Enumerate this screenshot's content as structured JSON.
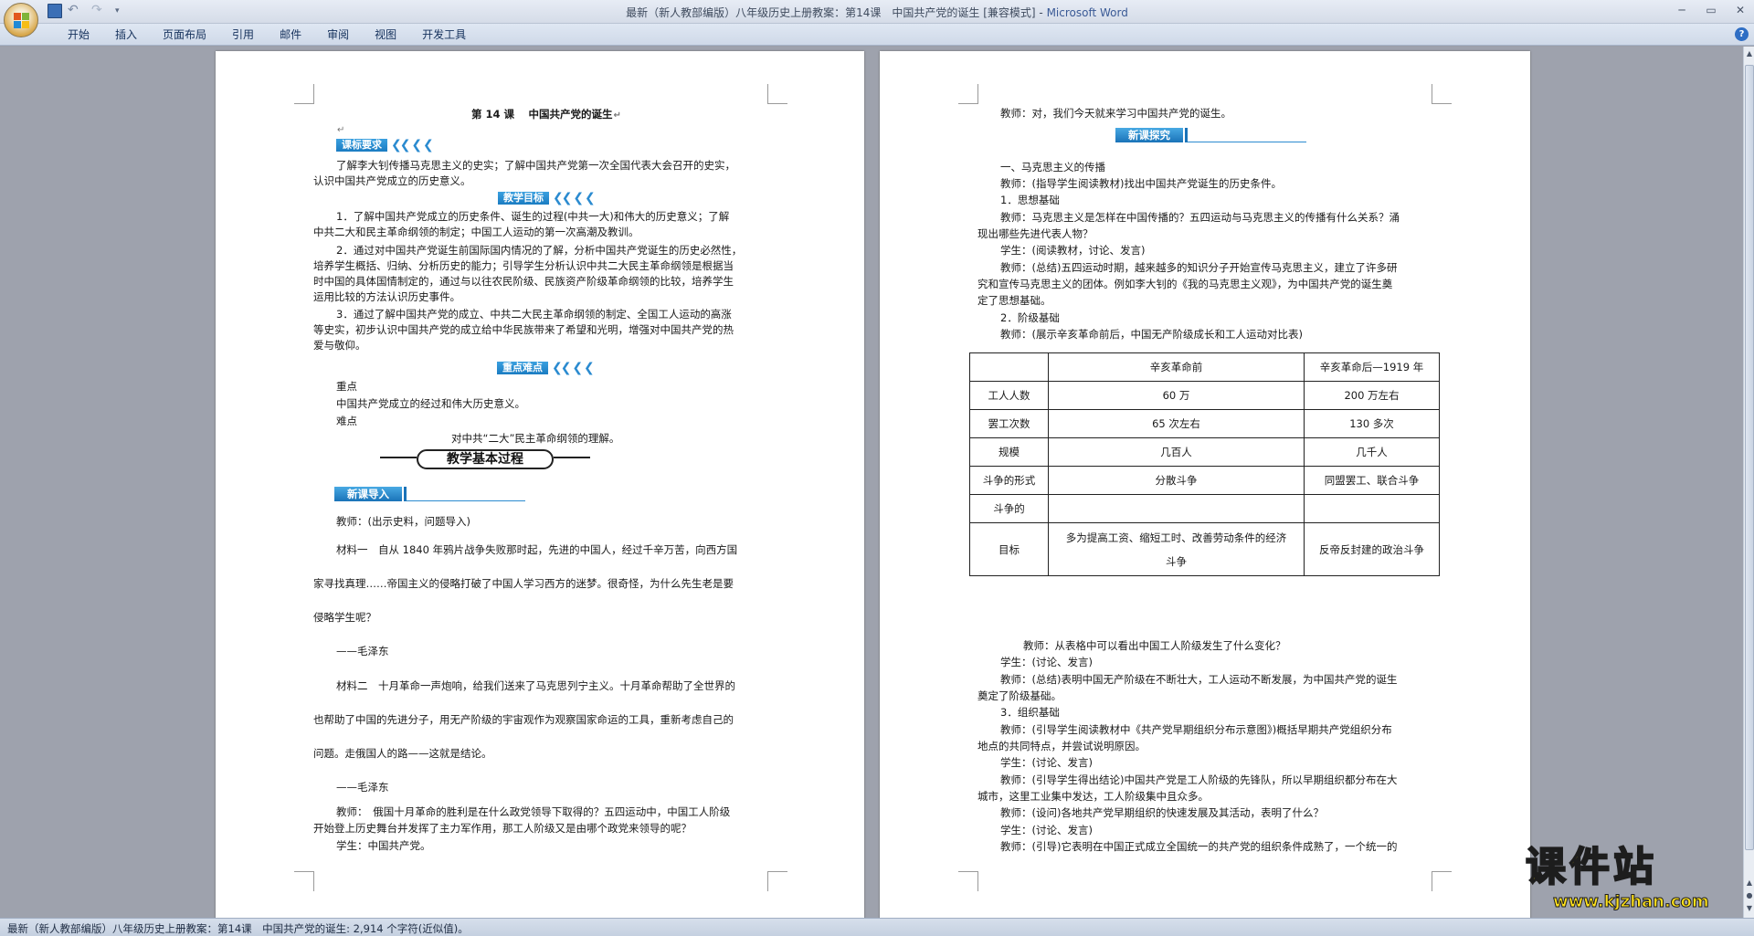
{
  "window": {
    "title": "最新（新人教部编版）八年级历史上册教案：第14课　中国共产党的诞生 [兼容模式]",
    "app_name": "Microsoft Word",
    "dash": " - "
  },
  "ribbon": {
    "tabs": [
      "开始",
      "插入",
      "页面布局",
      "引用",
      "邮件",
      "审阅",
      "视图",
      "开发工具"
    ],
    "help": "?"
  },
  "page1": {
    "title": "第 14 课　 中国共产党的诞生",
    "banner_kbyq": "课标要求",
    "kbyq_l1": "了解李大钊传播马克思主义的史实；了解中国共产党第一次全国代表大会召开的史实，",
    "kbyq_l2": "认识中国共产党成立的历史意义。",
    "banner_jxmb": "教学目标",
    "m1_l1": "1．了解中国共产党成立的历史条件、诞生的过程(中共一大)和伟大的历史意义；了解",
    "m1_l2": "中共二大和民主革命纲领的制定；中国工人运动的第一次高潮及教训。",
    "m2_l1": "2．通过对中国共产党诞生前国际国内情况的了解，分析中国共产党诞生的历史必然性，",
    "m2_l2": "培养学生概括、归纳、分析历史的能力；引导学生分析认识中共二大民主革命纲领是根据当",
    "m2_l3": "时中国的具体国情制定的，通过与以往农民阶级、民族资产阶级革命纲领的比较，培养学生",
    "m2_l4": "运用比较的方法认识历史事件。",
    "m3_l1": "3．通过了解中国共产党的成立、中共二大民主革命纲领的制定、全国工人运动的高涨",
    "m3_l2": "等史实，初步认识中国共产党的成立给中华民族带来了希望和光明，增强对中国共产党的热",
    "m3_l3": "爱与敬仰。",
    "banner_zdnd": "重点难点",
    "zd_label": "重点",
    "zd_text": "中国共产党成立的经过和伟大历史意义。",
    "nd_label": "难点",
    "nd_text": "对中共“二大”民主革命纲领的理解。",
    "process_title": "教学基本过程",
    "banner_xkdr": "新课导入",
    "t1": "教师：(出示史料，问题导入)",
    "mat1_l1": "材料一　自从 1840 年鸦片战争失败那时起，先进的中国人，经过千辛万苦，向西方国",
    "mat1_l2": "家寻找真理……帝国主义的侵略打破了中国人学习西方的迷梦。很奇怪，为什么先生老是要",
    "mat1_l3": "侵略学生呢？",
    "mat1_src": "——毛泽东",
    "mat2_l1": "材料二　十月革命一声炮响，给我们送来了马克思列宁主义。十月革命帮助了全世界的",
    "mat2_l2": "也帮助了中国的先进分子，用无产阶级的宇宙观作为观察国家命运的工具，重新考虑自己的",
    "mat2_l3": "问题。走俄国人的路——这就是结论。",
    "mat2_src": "——毛泽东",
    "t2_l1": "教师：　俄国十月革命的胜利是在什么政党领导下取得的？五四运动中，中国工人阶级",
    "t2_l2": "开始登上历史舞台并发挥了主力军作用，那工人阶级又是由哪个政党来领导的呢？",
    "s1": "学生：中国共产党。"
  },
  "page2": {
    "p1": "教师：对，我们今天就来学习中国共产党的诞生。",
    "banner_xktj": "新课探究",
    "h1": "一、马克思主义的传播",
    "t1": "教师：(指导学生阅读教材)找出中国共产党诞生的历史条件。",
    "h2": "1．思想基础",
    "t2_l1": "教师：马克思主义是怎样在中国传播的？五四运动与马克思主义的传播有什么关系？涌",
    "t2_l2": "现出哪些先进代表人物？",
    "s1": "学生：(阅读教材，讨论、发言)",
    "t3_l1": "教师：(总结)五四运动时期，越来越多的知识分子开始宣传马克思主义，建立了许多研",
    "t3_l2": "究和宣传马克思主义的团体。例如李大钊的《我的马克思主义观》，为中国共产党的诞生奠",
    "t3_l3": "定了思想基础。",
    "h3": "2．阶级基础",
    "t4": "教师：(展示辛亥革命前后，中国无产阶级成长和工人运动对比表)",
    "table": {
      "header": [
        "",
        "辛亥革命前",
        "辛亥革命后—1919 年"
      ],
      "rows": [
        [
          "工人人数",
          "60 万",
          "200 万左右"
        ],
        [
          "罢工次数",
          "65 次左右",
          "130 多次"
        ],
        [
          "规模",
          "几百人",
          "几千人"
        ],
        [
          "斗争的形式",
          "分散斗争",
          "同盟罢工、联合斗争"
        ],
        [
          "斗争的",
          "",
          ""
        ]
      ],
      "goal_label": "目标",
      "goal_before_l1": "多为提高工资、缩短工时、改善劳动条件的经济",
      "goal_before_l2": "斗争",
      "goal_after": "反帝反封建的政治斗争"
    },
    "t5": "教师：从表格中可以看出中国工人阶级发生了什么变化？",
    "s2": "学生：(讨论、发言)",
    "t6_l1": "教师：(总结)表明中国无产阶级在不断壮大，工人运动不断发展，为中国共产党的诞生",
    "t6_l2": "奠定了阶级基础。",
    "h4": "3．组织基础",
    "t7_l1": "教师：(引导学生阅读教材中《共产党早期组织分布示意图》)概括早期共产党组织分布",
    "t7_l2": "地点的共同特点，并尝试说明原因。",
    "s3": "学生：(讨论、发言)",
    "t8_l1": "教师：(引导学生得出结论)中国共产党是工人阶级的先锋队，所以早期组织都分布在大",
    "t8_l2": "城市，这里工业集中发达，工人阶级集中且众多。",
    "t9": "教师：(设问)各地共产党早期组织的快速发展及其活动，表明了什么？",
    "s4": "学生：(讨论、发言)",
    "t10": "教师：(引导)它表明在中国正式成立全国统一的共产党的组织条件成熟了，一个统一的"
  },
  "status": {
    "text": "最新（新人教部编版）八年级历史上册教案：第14课　中国共产党的诞生: 2,914 个字符(近似值)。"
  },
  "watermark": {
    "cn": "课件站",
    "url": "www.kjzhan.com"
  },
  "paragraph_mark": "↵",
  "colors": {
    "banner": "#1b7cc2",
    "title_app": "#3a5a96",
    "watermark": "#ffe21a"
  }
}
